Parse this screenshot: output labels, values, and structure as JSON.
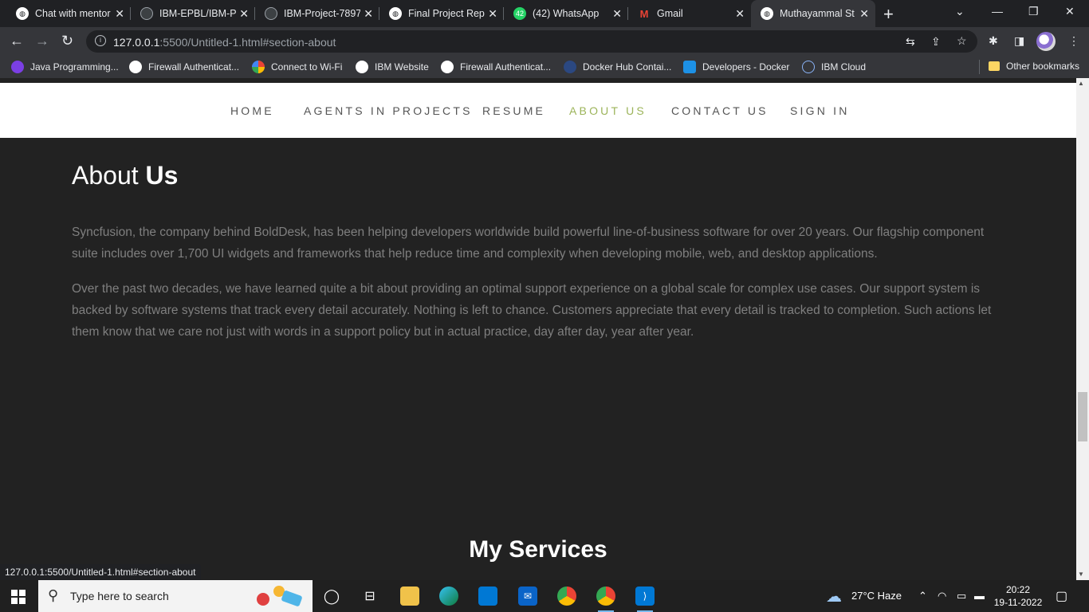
{
  "browser": {
    "tabs": [
      {
        "title": "Chat with mentor",
        "icon": "globe-icon"
      },
      {
        "title": "IBM-EPBL/IBM-Pr",
        "icon": "github-icon"
      },
      {
        "title": "IBM-Project-7897",
        "icon": "github-icon"
      },
      {
        "title": "Final Project Rep",
        "icon": "globe-icon"
      },
      {
        "title": "(42) WhatsApp",
        "icon": "whatsapp-icon",
        "badge": "42"
      },
      {
        "title": "Gmail",
        "icon": "gmail-icon"
      },
      {
        "title": "Muthayammal St",
        "icon": "globe-icon",
        "active": true
      }
    ],
    "new_tab": "+",
    "url_host": "127.0.0.1",
    "url_rest": ":5500/Untitled-1.html#section-about",
    "bookmarks": [
      {
        "label": "Java Programming...",
        "icon": "purple-icon"
      },
      {
        "label": "Firewall Authenticat...",
        "icon": "globe-icon"
      },
      {
        "label": "Connect to Wi-Fi",
        "icon": "google-icon"
      },
      {
        "label": "IBM Website",
        "icon": "globe-icon"
      },
      {
        "label": "Firewall Authenticat...",
        "icon": "globe-icon"
      },
      {
        "label": "Docker Hub Contai...",
        "icon": "docker-icon"
      },
      {
        "label": "Developers - Docker",
        "icon": "docker-icon"
      },
      {
        "label": "IBM Cloud",
        "icon": "cloud-icon"
      }
    ],
    "other_bookmarks": "Other bookmarks",
    "status_url": "127.0.0.1:5500/Untitled-1.html#section-about"
  },
  "site": {
    "nav": [
      "HOME",
      "AGENTS IN PROJECTS",
      "RESUME",
      "ABOUT US",
      "CONTACT US",
      "SIGN IN"
    ],
    "active_nav": "ABOUT US",
    "accent_color": "#9cb45a",
    "about_title_light": "About ",
    "about_title_bold": "Us",
    "paragraph1": "Syncfusion, the company behind BoldDesk, has been helping developers worldwide build powerful line-of-business software for over 20 years. Our flagship component suite includes over 1,700 UI widgets and frameworks that help reduce time and complexity when developing mobile, web, and desktop applications.",
    "paragraph2": "Over the past two decades, we have learned quite a bit about providing an optimal support experience on a global scale for complex use cases. Our support system is backed by software systems that track every detail accurately. Nothing is left to chance. Customers appreciate that every detail is tracked to completion. Such actions let them know that we care not just with words in a support policy but in actual practice, day after day, year after year.",
    "services_title_light": "My ",
    "services_title_bold": "Services"
  },
  "taskbar": {
    "search_placeholder": "Type here to search",
    "weather": "27°C  Haze",
    "time": "20:22",
    "date": "19-11-2022"
  }
}
